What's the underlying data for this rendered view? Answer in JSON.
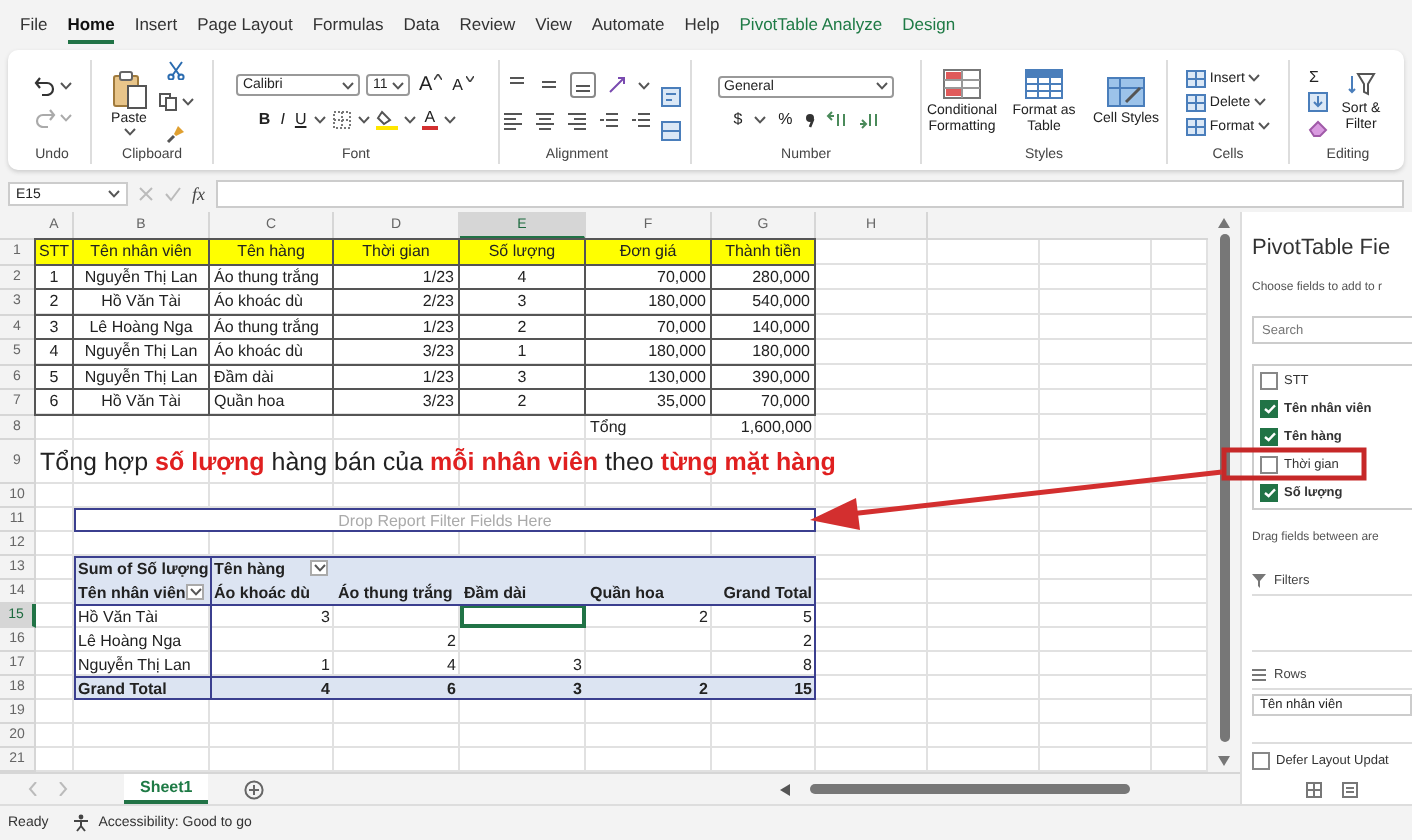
{
  "menu_tabs": [
    {
      "label": "File",
      "selected": false,
      "contextual": false
    },
    {
      "label": "Home",
      "selected": true,
      "contextual": false
    },
    {
      "label": "Insert",
      "selected": false,
      "contextual": false
    },
    {
      "label": "Page Layout",
      "selected": false,
      "contextual": false
    },
    {
      "label": "Formulas",
      "selected": false,
      "contextual": false
    },
    {
      "label": "Data",
      "selected": false,
      "contextual": false
    },
    {
      "label": "Review",
      "selected": false,
      "contextual": false
    },
    {
      "label": "View",
      "selected": false,
      "contextual": false
    },
    {
      "label": "Automate",
      "selected": false,
      "contextual": false
    },
    {
      "label": "Help",
      "selected": false,
      "contextual": false
    },
    {
      "label": "PivotTable Analyze",
      "selected": false,
      "contextual": true
    },
    {
      "label": "Design",
      "selected": false,
      "contextual": true
    }
  ],
  "ribbon": {
    "undo": {
      "label": "Undo"
    },
    "clipboard": {
      "label": "Clipboard",
      "paste": "Paste"
    },
    "font": {
      "label": "Font",
      "family": "Calibri",
      "size": "11",
      "grow": "A",
      "shrink": "A",
      "bold": "B",
      "italic": "I",
      "underline": "U",
      "color_button": "A"
    },
    "alignment": {
      "label": "Alignment"
    },
    "number": {
      "label": "Number",
      "format": "General",
      "currency": "$",
      "percent": "%"
    },
    "styles": {
      "label": "Styles",
      "buttons": [
        "Conditional Formatting",
        "Format as Table",
        "Cell Styles"
      ]
    },
    "cells": {
      "label": "Cells",
      "buttons": [
        "Insert",
        "Delete",
        "Format"
      ]
    },
    "editing": {
      "label": "Editing",
      "autosum": "Σ",
      "sort": "Sort & Filter"
    }
  },
  "formula_bar": {
    "name_box": "E15",
    "fx": "fx"
  },
  "sheet": {
    "columns": [
      {
        "label": "A",
        "selected": false
      },
      {
        "label": "B",
        "selected": false
      },
      {
        "label": "C",
        "selected": false
      },
      {
        "label": "D",
        "selected": false
      },
      {
        "label": "E",
        "selected": true
      },
      {
        "label": "F",
        "selected": false
      },
      {
        "label": "G",
        "selected": false
      },
      {
        "label": "H",
        "selected": false
      }
    ],
    "rows": [
      {
        "label": "1",
        "selected": false
      },
      {
        "label": "2",
        "selected": false
      },
      {
        "label": "3",
        "selected": false
      },
      {
        "label": "4",
        "selected": false
      },
      {
        "label": "5",
        "selected": false
      },
      {
        "label": "6",
        "selected": false
      },
      {
        "label": "7",
        "selected": false
      },
      {
        "label": "8",
        "selected": false
      },
      {
        "label": "9",
        "selected": false
      },
      {
        "label": "10",
        "selected": false
      },
      {
        "label": "11",
        "selected": false
      },
      {
        "label": "12",
        "selected": false
      },
      {
        "label": "13",
        "selected": false
      },
      {
        "label": "14",
        "selected": false
      },
      {
        "label": "15",
        "selected": true
      },
      {
        "label": "16",
        "selected": false
      },
      {
        "label": "17",
        "selected": false
      },
      {
        "label": "18",
        "selected": false
      },
      {
        "label": "19",
        "selected": false
      },
      {
        "label": "20",
        "selected": false
      },
      {
        "label": "21",
        "selected": false
      }
    ]
  },
  "table": {
    "headers": [
      "STT",
      "Tên nhân viên",
      "Tên hàng",
      "Thời gian",
      "Số lượng",
      "Đơn giá",
      "Thành tiền"
    ],
    "rows": [
      [
        "1",
        "Nguyễn Thị Lan",
        "Áo thung trắng",
        "1/23",
        "4",
        "70,000",
        "280,000"
      ],
      [
        "2",
        "Hồ Văn Tài",
        "Áo khoác dù",
        "2/23",
        "3",
        "180,000",
        "540,000"
      ],
      [
        "3",
        "Lê Hoàng Nga",
        "Áo thung trắng",
        "1/23",
        "2",
        "70,000",
        "140,000"
      ],
      [
        "4",
        "Nguyễn Thị Lan",
        "Áo khoác dù",
        "3/23",
        "1",
        "180,000",
        "180,000"
      ],
      [
        "5",
        "Nguyễn Thị Lan",
        "Đầm dài",
        "1/23",
        "3",
        "130,000",
        "390,000"
      ],
      [
        "6",
        "Hồ Văn Tài",
        "Quần hoa",
        "3/23",
        "2",
        "35,000",
        "70,000"
      ]
    ],
    "total": {
      "label": "Tổng",
      "value": "1,600,000"
    }
  },
  "title": "Tổng hợp **số lượng** hàng bán của **mỗi nhân viên** theo **từng mặt hàng**",
  "pivot": {
    "filter_zone": "Drop Report Filter Fields Here",
    "value_label": "Sum of Số lượng",
    "column_field": "Tên hàng",
    "row_field": "Tên nhân viên",
    "column_headers": [
      "Áo khoác dù",
      "Áo thung trắng",
      "Đầm dài",
      "Quần hoa",
      "Grand Total"
    ],
    "rows": [
      {
        "label": "Hồ Văn Tài",
        "cells": [
          {
            "value": "3",
            "selected": false
          },
          {
            "selected": false
          },
          {
            "selected": true
          },
          {
            "value": "2",
            "selected": false
          },
          {
            "value": "5",
            "selected": false
          }
        ]
      },
      {
        "label": "Lê Hoàng Nga",
        "cells": [
          {
            "selected": false
          },
          {
            "value": "2",
            "selected": false
          },
          {
            "selected": false
          },
          {
            "selected": false
          },
          {
            "value": "2",
            "selected": false
          }
        ]
      },
      {
        "label": "Nguyễn Thị Lan",
        "cells": [
          {
            "value": "1",
            "selected": false
          },
          {
            "value": "4",
            "selected": false
          },
          {
            "value": "3",
            "selected": false
          },
          {
            "selected": false
          },
          {
            "value": "8",
            "selected": false
          }
        ]
      }
    ],
    "grand_total": {
      "label": "Grand Total",
      "values": [
        "4",
        "6",
        "3",
        "2",
        "15"
      ]
    }
  },
  "sheet_tabs": [
    {
      "label": "Sheet1",
      "selected": true
    }
  ],
  "status_bar": {
    "mode": "Ready",
    "accessibility": "Accessibility: Good to go"
  },
  "panel": {
    "title": "PivotTable Fie",
    "hint": "Choose fields to add to r",
    "search": {
      "placeholder": "Search"
    },
    "fields": [
      {
        "label": "STT",
        "checked": false
      },
      {
        "label": "Tên nhân viên",
        "checked": true
      },
      {
        "label": "Tên hàng",
        "checked": true
      },
      {
        "label": "Thời gian",
        "checked": false
      },
      {
        "label": "Số lượng",
        "checked": true
      }
    ],
    "drag_hint": "Drag fields between are",
    "areas": [
      {
        "kind": "filters",
        "label": "Filters"
      },
      {
        "kind": "rows",
        "label": "Rows",
        "items": [
          "Tên nhân viên"
        ]
      }
    ],
    "defer": {
      "label": "Defer Layout Updat",
      "checked": false
    }
  }
}
